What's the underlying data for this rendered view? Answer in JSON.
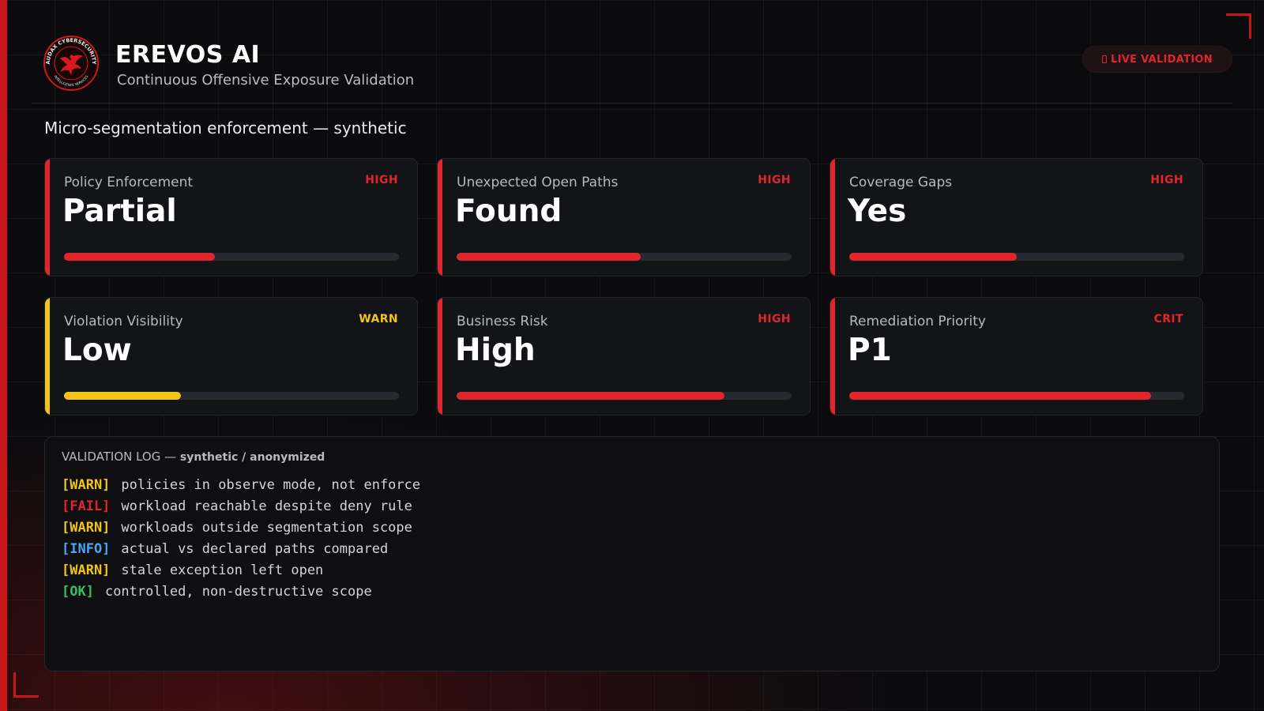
{
  "app": {
    "title": "EREVOS AI",
    "subtitle": "Continuous Offensive Exposure Validation",
    "live_badge": "LIVE VALIDATION",
    "logo": {
      "ring_text_top": "AUDAX CYBERSECURITY",
      "ring_text_bottom": "INTELLIGENCE SERVICES",
      "icon": "eagle-emblem-icon",
      "color": "#d0171d"
    }
  },
  "section_title": "Micro-segmentation enforcement — synthetic",
  "colors": {
    "accent_red": "#e0262c",
    "accent_yellow": "#f2c318",
    "info_blue": "#4da3f5",
    "ok_green": "#30c46a"
  },
  "metrics": [
    {
      "label": "Policy Enforcement",
      "value": "Partial",
      "severity": "HIGH",
      "accent": "#e0262c",
      "progress_pct": 45
    },
    {
      "label": "Unexpected Open Paths",
      "value": "Found",
      "severity": "HIGH",
      "accent": "#e0262c",
      "progress_pct": 55
    },
    {
      "label": "Coverage Gaps",
      "value": "Yes",
      "severity": "HIGH",
      "accent": "#e0262c",
      "progress_pct": 50
    },
    {
      "label": "Violation Visibility",
      "value": "Low",
      "severity": "WARN",
      "accent": "#f2c318",
      "progress_pct": 35
    },
    {
      "label": "Business Risk",
      "value": "High",
      "severity": "HIGH",
      "accent": "#e0262c",
      "progress_pct": 80
    },
    {
      "label": "Remediation Priority",
      "value": "P1",
      "severity": "CRIT",
      "accent": "#e0262c",
      "progress_pct": 90
    }
  ],
  "log": {
    "title": "VALIDATION LOG —",
    "subtitle": "synthetic / anonymized",
    "entries": [
      {
        "tag": "[WARN]",
        "text": "policies in observe mode, not enforce",
        "color": "#f2c318"
      },
      {
        "tag": "[FAIL]",
        "text": "workload reachable despite deny rule",
        "color": "#e0262c"
      },
      {
        "tag": "[WARN]",
        "text": "workloads outside segmentation scope",
        "color": "#f2c318"
      },
      {
        "tag": "[INFO]",
        "text": "actual vs declared paths compared",
        "color": "#4da3f5"
      },
      {
        "tag": "[WARN]",
        "text": "stale exception left open",
        "color": "#f2c318"
      },
      {
        "tag": "[OK]",
        "text": "controlled, non-destructive scope",
        "color": "#30c46a"
      }
    ]
  }
}
